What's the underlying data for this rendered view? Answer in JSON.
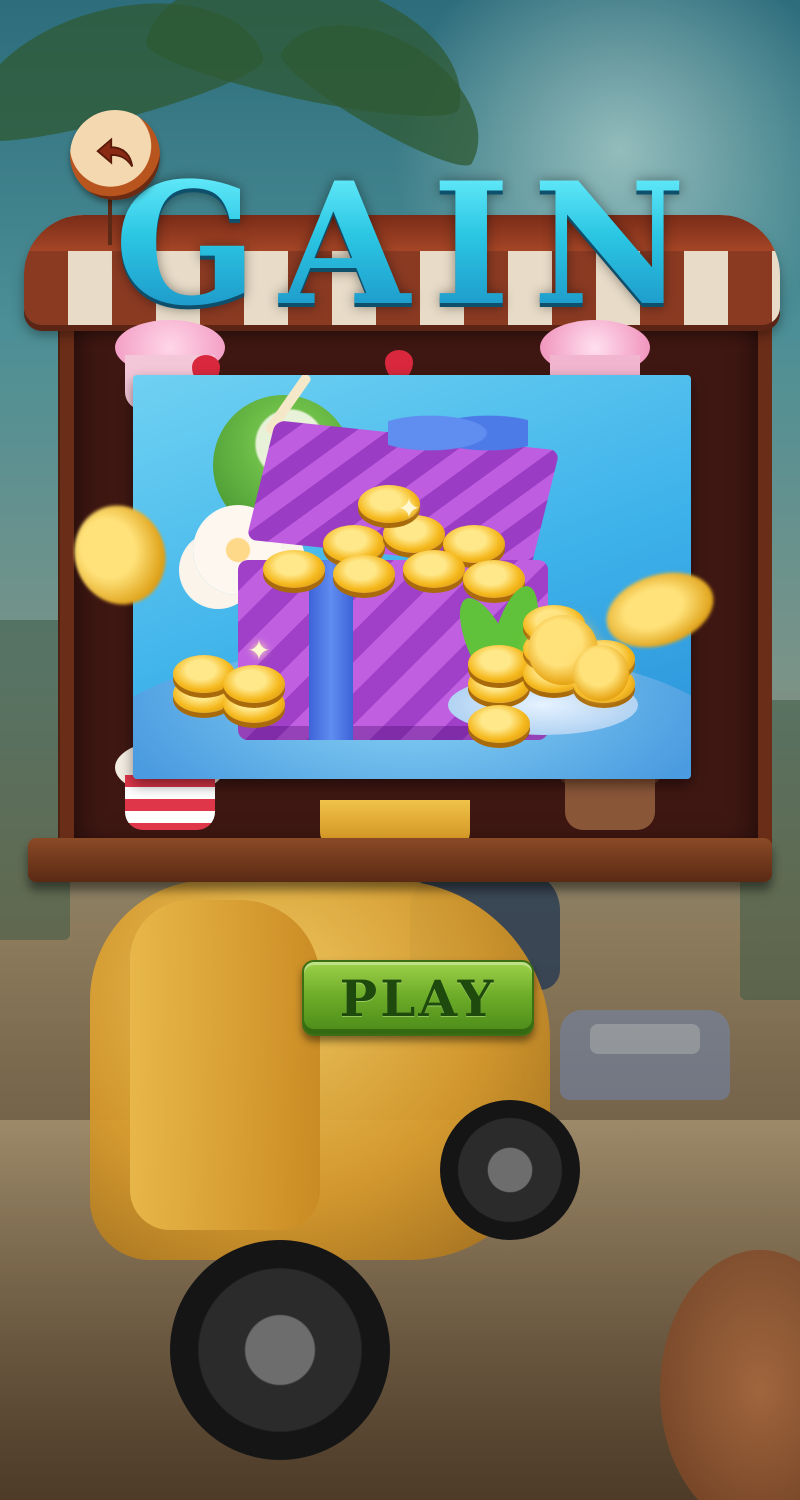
{
  "screen": {
    "title": "GAIN",
    "title_color": "#38d6e6"
  },
  "back_button": {
    "icon": "back-arrow-icon"
  },
  "play_button": {
    "label": "PLAY",
    "color": "#6fae2a"
  },
  "reward_image": {
    "subject": "gift-box-with-coins-icon"
  }
}
